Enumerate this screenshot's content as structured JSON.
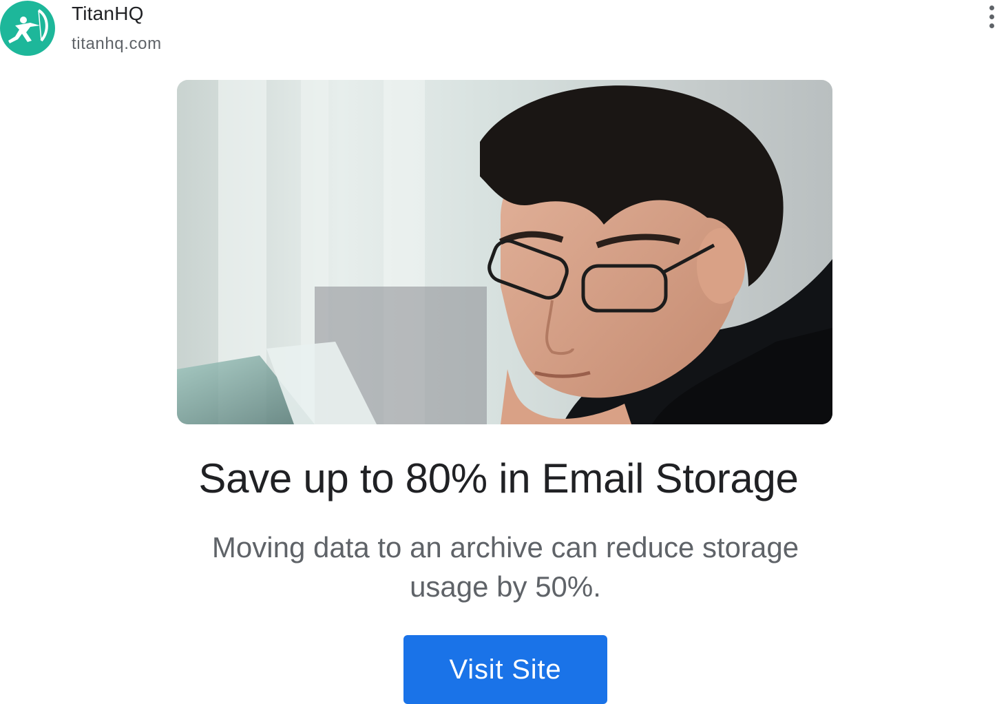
{
  "advertiser": {
    "name": "TitanHQ",
    "domain": "titanhq.com",
    "logo_icon": "archer-icon",
    "logo_color": "#1db79a"
  },
  "menu": {
    "icon": "more-vert-icon"
  },
  "hero_image": {
    "description_icon": "man-with-glasses-photo"
  },
  "headline": "Save up to 80% in Email Storage",
  "body": "Moving data to an archive can reduce storage usage by 50%.",
  "cta": {
    "label": "Visit Site",
    "color": "#1a73e8"
  }
}
